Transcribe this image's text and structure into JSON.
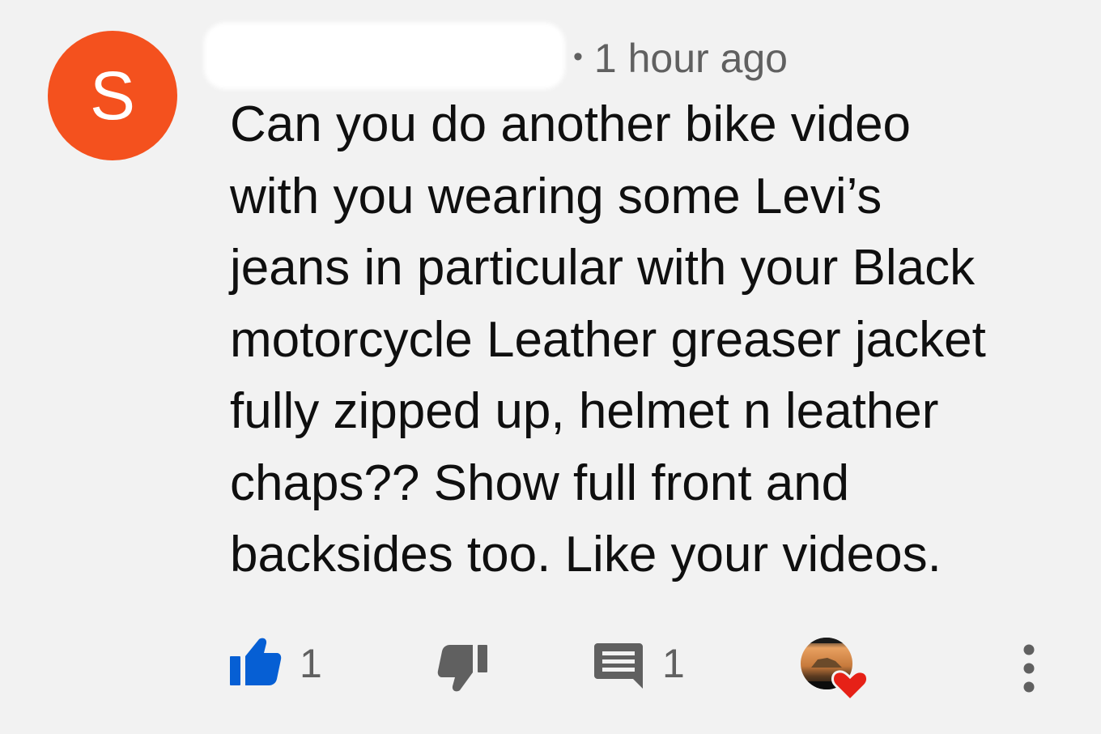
{
  "comment": {
    "avatar": {
      "letter": "S",
      "color": "#f4511e"
    },
    "timestamp": "1 hour ago",
    "separator": "•",
    "text": "Can you do another bike video\nwith you wearing some Levi’s\njeans in particular with your Black\nmotorcycle Leather greaser jacket\nfully zipped up, helmet n leather\nchaps?? Show full front and\nbacksides too. Like your videos."
  },
  "actions": {
    "like_count": "1",
    "reply_count": "1",
    "like_active_color": "#065fd4",
    "icon_color": "#606060",
    "heart_color": "#e62117",
    "icons": {
      "like": "thumbs-up-icon",
      "dislike": "thumbs-down-icon",
      "reply": "comment-reply-icon",
      "creator_heart": "creator-heart-icon",
      "more": "more-vertical-icon"
    }
  }
}
